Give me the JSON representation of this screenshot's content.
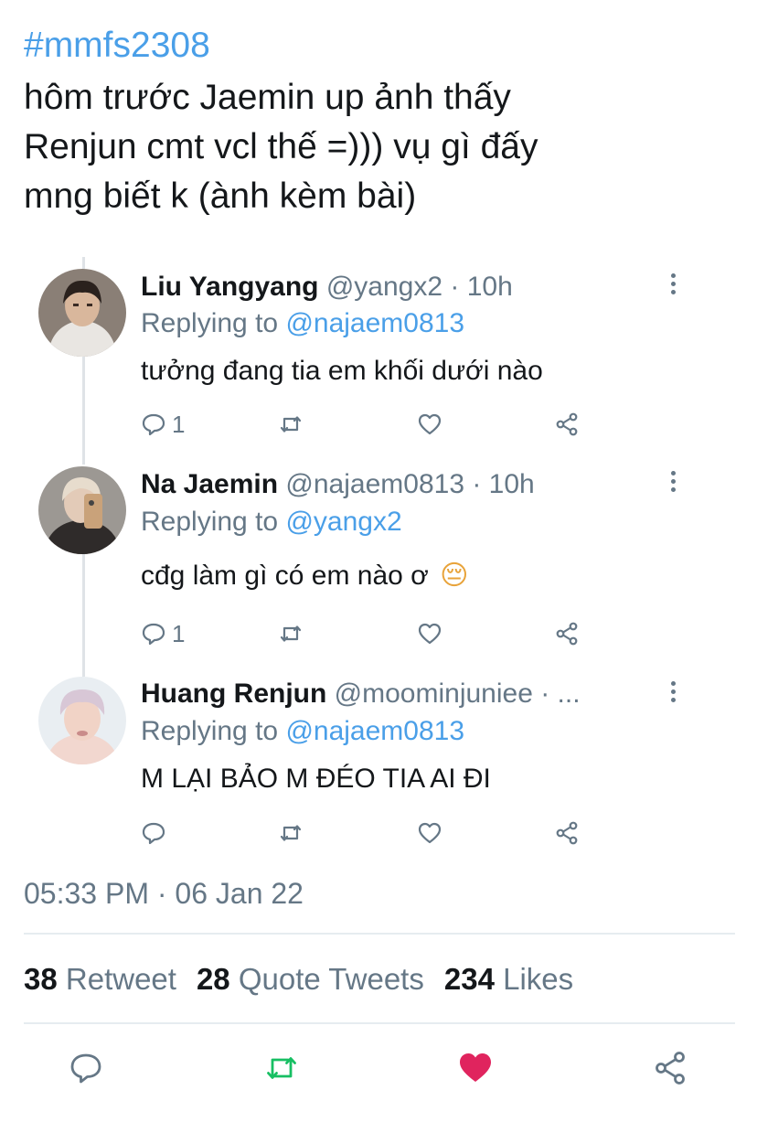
{
  "tweet": {
    "hashtag": "#mmfs2308",
    "text_lines": [
      "hôm trước Jaemin up ảnh thấy",
      "Renjun cmt vcl thế =))) vụ gì đấy",
      "mng biết k (ành kèm bài)"
    ]
  },
  "replies": [
    {
      "name": "Liu Yangyang",
      "handle": "@yangx2 · 10h",
      "replying_label": "Replying to ",
      "replying_to": "@najaem0813",
      "body": "tưởng đang tia em khối dưới nào",
      "reply_count": "1",
      "avatar_icon": "avatar-photo"
    },
    {
      "name": "Na Jaemin",
      "handle": "@najaem0813 · 10h",
      "replying_label": "Replying to ",
      "replying_to": "@yangx2",
      "body": "cđg làm gì có em nào ơ",
      "emoji": "😔",
      "reply_count": "1",
      "avatar_icon": "avatar-photo"
    },
    {
      "name": "Huang Renjun",
      "handle": "@moominjuniee · ...",
      "replying_label": "Replying to ",
      "replying_to": "@najaem0813",
      "body": "M LẠI BẢO M ĐÉO TIA AI ĐI",
      "reply_count": "",
      "avatar_icon": "avatar-photo"
    }
  ],
  "timestamp": "05:33 PM · 06 Jan 22",
  "stats": {
    "retweets": "38",
    "retweets_label": "Retweet",
    "quotes": "28",
    "quotes_label": "Quote Tweets",
    "likes": "234",
    "likes_label": "Likes"
  },
  "colors": {
    "accent_blue": "#4a9fe8",
    "retweet_green": "#17bf63",
    "like_red": "#e0245e",
    "muted_gray": "#657786"
  },
  "icons": {
    "reply": "reply-icon",
    "retweet": "retweet-icon",
    "like": "heart-icon",
    "share": "share-icon",
    "more": "more-options-icon"
  }
}
